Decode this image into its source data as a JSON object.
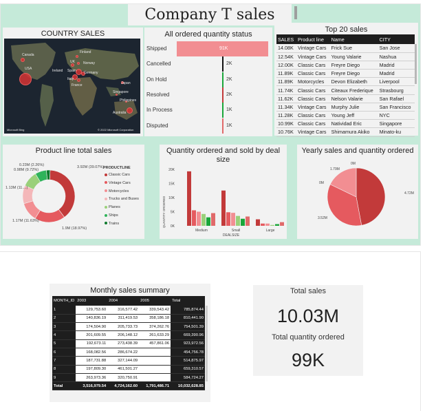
{
  "header": {
    "title": "Company T sales"
  },
  "country_sales": {
    "title": "COUNTRY SALES",
    "labels": [
      "Canada",
      "Finland",
      "UK",
      "Norway",
      "USA",
      "Ireland",
      "Spain",
      "Germany",
      "Italy",
      "France",
      "Japan",
      "Singapore",
      "Philippines",
      "Australia"
    ],
    "attribution_left": "Microsoft Bing",
    "attribution_right": "© 2022 Microsoft Corporation"
  },
  "order_status": {
    "title": "All ordered quantity status",
    "rows": [
      {
        "label": "Shipped",
        "value": "91K",
        "qty": 91,
        "color": "#f28e92"
      },
      {
        "label": "Cancelled",
        "value": "2K",
        "qty": 2,
        "color": "#111111"
      },
      {
        "label": "On Hold",
        "value": "2K",
        "qty": 2,
        "color": "#1aa63a"
      },
      {
        "label": "Resolved",
        "value": "2K",
        "qty": 2,
        "color": "#c23a3a"
      },
      {
        "label": "In Process",
        "value": "1K",
        "qty": 1,
        "color": "#1aa63a"
      },
      {
        "label": "Disputed",
        "value": "1K",
        "qty": 1,
        "color": "#e06a6a"
      }
    ]
  },
  "top20": {
    "title": "Top 20 sales",
    "columns": [
      "SALES",
      "Product line",
      "Name",
      "CITY"
    ],
    "rows": [
      [
        "14.08K",
        "Vintage Cars",
        "Frick Sue",
        "San Jose"
      ],
      [
        "12.54K",
        "Vintage Cars",
        "Young Valarie",
        "Nashua"
      ],
      [
        "12.00K",
        "Classic Cars",
        "Freyre Diego",
        "Madrid"
      ],
      [
        "11.89K",
        "Classic Cars",
        "Freyre Diego",
        "Madrid"
      ],
      [
        "11.89K",
        "Motorcycles",
        "Devon Elizabeth",
        "Liverpool"
      ],
      [
        "11.74K",
        "Classic Cars",
        "Citeaux Frederique",
        "Strasbourg"
      ],
      [
        "11.62K",
        "Classic Cars",
        "Nelson Valarie",
        "San Rafael"
      ],
      [
        "11.34K",
        "Vintage Cars",
        "Murphy Julie",
        "San Francisco"
      ],
      [
        "11.28K",
        "Classic Cars",
        "Young Jeff",
        "NYC"
      ],
      [
        "10.99K",
        "Classic Cars",
        "Natividad Eric",
        "Singapore"
      ],
      [
        "10.76K",
        "Vintage Cars",
        "Shimamura Akiko",
        "Minato-ku"
      ]
    ]
  },
  "chart_data": [
    {
      "type": "pie",
      "title": "Product line total sales",
      "legend_title": "PRODUCTLINE",
      "categories": [
        "Classic Cars",
        "Vintage Cars",
        "Motorcycles",
        "Trucks and Buses",
        "Planes",
        "Ships",
        "Trains"
      ],
      "values": [
        3.92,
        1.9,
        1.17,
        1.13,
        0.98,
        0.71,
        0.23
      ],
      "colors": [
        "#c23a3a",
        "#e55a5f",
        "#f28e92",
        "#f4b7b9",
        "#9ad07a",
        "#2fb35a",
        "#0e7a2c"
      ],
      "data_labels": [
        "3.92M (39.07%)",
        "1.9M (18.97%)",
        "1.17M (11.63%)",
        "1.13M (11....)",
        "0.98M (9.72%)",
        "",
        "0.23M (2.26%)"
      ]
    },
    {
      "type": "bar",
      "title": "Quantity ordered and sold by deal size",
      "xlabel": "DEALSIZE",
      "ylabel": "QUANTITY ORDERED",
      "categories": [
        "Medium",
        "Small",
        "Large"
      ],
      "yticks": [
        "0K",
        "5K",
        "10K",
        "15K",
        "20K"
      ],
      "ylim": [
        0,
        20
      ],
      "series_colors": [
        "#c23a3a",
        "#e55a5f",
        "#f28e92",
        "#9ad07a",
        "#1aa63a",
        "#e06a6a"
      ],
      "series_values": [
        [
          19.3,
          5.5,
          5.0,
          4.2,
          3.0,
          4.5
        ],
        [
          12.5,
          4.8,
          4.6,
          3.5,
          2.5,
          3.3
        ],
        [
          2.3,
          0.8,
          0.8,
          0.3,
          0.6,
          1.3
        ]
      ]
    },
    {
      "type": "pie",
      "title": "Yearly sales and quantity ordered",
      "values": [
        4.72,
        3.52,
        1.79,
        0.0,
        0.0
      ],
      "labels": [
        "4.72M",
        "3.52M",
        "1.79M",
        "0M",
        "0M"
      ],
      "colors": [
        "#c23a3a",
        "#e55a5f",
        "#f28e92",
        "#333333",
        "#333333"
      ]
    }
  ],
  "monthly": {
    "title": "Monthly sales summary",
    "columns": [
      "MONTH_ID",
      "2003",
      "2004",
      "2005",
      "Total"
    ],
    "rows": [
      [
        "1",
        "129,753.60",
        "316,577.42",
        "339,543.42",
        "785,874.44"
      ],
      [
        "2",
        "140,836.19",
        "311,419.53",
        "358,186.18",
        "810,441.90"
      ],
      [
        "3",
        "174,504.90",
        "205,733.73",
        "374,262.76",
        "754,501.39"
      ],
      [
        "4",
        "201,609.55",
        "206,148.12",
        "261,633.29",
        "669,390.96"
      ],
      [
        "5",
        "192,673.11",
        "273,438.39",
        "457,861.06",
        "923,972.56"
      ],
      [
        "6",
        "168,082.56",
        "286,674.22",
        "",
        "454,756.78"
      ],
      [
        "7",
        "187,731.88",
        "327,144.09",
        "",
        "514,875.97"
      ],
      [
        "8",
        "197,809.30",
        "461,501.27",
        "",
        "659,310.57"
      ],
      [
        "9",
        "263,973.36",
        "320,750.91",
        "",
        "584,724.27"
      ]
    ],
    "total": [
      "Total",
      "3,516,979.54",
      "4,724,162.60",
      "1,791,486.71",
      "10,032,628.85"
    ]
  },
  "kpis": {
    "total_sales_label": "Total sales",
    "total_sales_value": "10.03M",
    "total_qty_label": "Total quantity ordered",
    "total_qty_value": "99K"
  }
}
